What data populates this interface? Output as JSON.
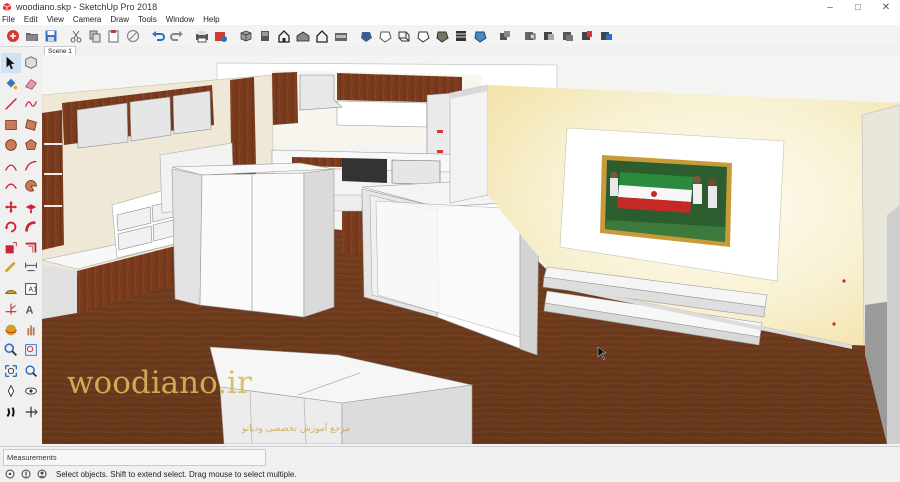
{
  "window": {
    "title": "woodiano.skp - SketchUp Pro 2018",
    "minimize_glyph": "–",
    "maximize_glyph": "□",
    "close_glyph": "✕"
  },
  "menu": [
    "File",
    "Edit",
    "View",
    "Camera",
    "Draw",
    "Tools",
    "Window",
    "Help"
  ],
  "toolbar_icons": [
    "getting-started-icon",
    "open-icon",
    "save-icon",
    "cut-icon",
    "copy-icon",
    "paste-icon",
    "erase-icon",
    "undo-icon",
    "redo-icon",
    "print-icon",
    "model-info-icon",
    "iso-view-icon",
    "top-view-icon",
    "front-view-icon",
    "right-view-icon",
    "back-view-icon",
    "left-view-icon",
    "xray-icon",
    "back-edges-icon",
    "wireframe-icon",
    "hidden-line-icon",
    "shaded-icon",
    "shaded-textures-icon",
    "monochrome-icon",
    "component-icon",
    "section-plane-icon",
    "section-cut-icon",
    "section-fill-icon",
    "display-section-icon",
    "section-planes-icon"
  ],
  "left_tools": [
    "select-icon",
    "make-component-icon",
    "paint-bucket-icon",
    "eraser-icon",
    "line-icon",
    "freehand-icon",
    "rectangle-icon",
    "rotated-rectangle-icon",
    "circle-icon",
    "polygon-icon",
    "arc-icon",
    "two-point-arc-icon",
    "three-point-arc-icon",
    "pie-icon",
    "move-icon",
    "push-pull-icon",
    "rotate-icon",
    "follow-me-icon",
    "scale-icon",
    "offset-icon",
    "tape-measure-icon",
    "dimension-icon",
    "protractor-icon",
    "text-icon",
    "axes-icon",
    "3d-text-icon",
    "orbit-icon",
    "pan-icon",
    "zoom-icon",
    "zoom-window-icon",
    "zoom-extents-icon",
    "previous-view-icon",
    "position-camera-icon",
    "look-around-icon",
    "walk-icon",
    "section-plane-tool-icon"
  ],
  "scene_tab": "Scene 1",
  "watermark": {
    "brand": "woodiano.ir",
    "tagline": "مرجع آموزش تخصصی ودیانو"
  },
  "measurements_label": "Measurements",
  "status_text": "Select objects. Shift to extend select. Drag mouse to select multiple.",
  "colors": {
    "wood": "#7a3a1c",
    "floor": "#6b3a1e",
    "white_panel": "#f2f2f2",
    "wall": "#f4eed8",
    "accent": "#c98a2a"
  }
}
